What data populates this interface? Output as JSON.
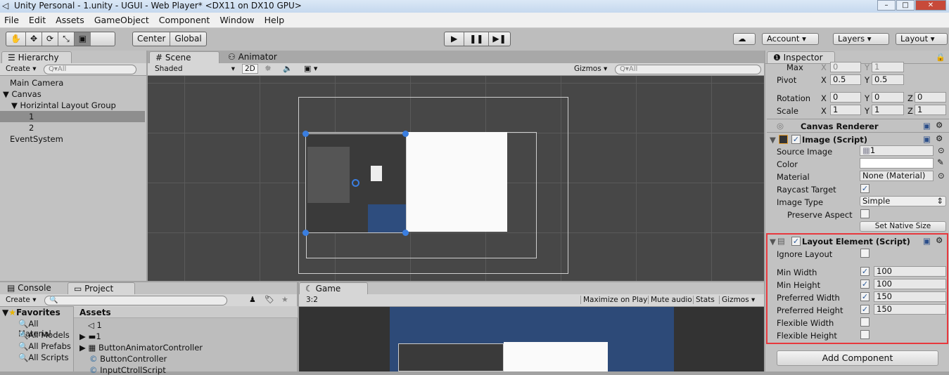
{
  "window": {
    "title": "Unity Personal - 1.unity - UGUI - Web Player* <DX11 on DX10 GPU>",
    "controls": [
      "–",
      "□",
      "✕"
    ]
  },
  "menu": [
    "File",
    "Edit",
    "Assets",
    "GameObject",
    "Component",
    "Window",
    "Help"
  ],
  "toolbar": {
    "tools": [
      "✋",
      "✥",
      "⟳",
      "⤡",
      "▣"
    ],
    "pivot": "Center",
    "space": "Global",
    "play": "▶",
    "pause": "❚❚",
    "step": "▶❚",
    "cloud": "☁",
    "account": "Account",
    "layers": "Layers",
    "layout": "Layout"
  },
  "hierarchy": {
    "tab": "Hierarchy",
    "create": "Create",
    "search": "Q▾All",
    "items": [
      {
        "label": "Main Camera",
        "indent": 0
      },
      {
        "label": "Canvas",
        "indent": 0,
        "arrow": "▼"
      },
      {
        "label": "Horizintal Layout Group",
        "indent": 1,
        "arrow": "▼"
      },
      {
        "label": "1",
        "indent": 2,
        "selected": true
      },
      {
        "label": "2",
        "indent": 2
      },
      {
        "label": "EventSystem",
        "indent": 0
      }
    ]
  },
  "scene": {
    "tab": "Scene",
    "tab2": "Animator",
    "shading": "Shaded",
    "mode2d": "2D",
    "gizmos": "Gizmos",
    "search": "Q▾All"
  },
  "inspector": {
    "tab": "Inspector",
    "rect": {
      "max_label": "Max",
      "max_x": "0",
      "max_y": "1",
      "pivot_label": "Pivot",
      "pivot_x": "0.5",
      "pivot_y": "0.5",
      "rotation_label": "Rotation",
      "rot_x": "0",
      "rot_y": "0",
      "rot_z": "0",
      "scale_label": "Scale",
      "scale_x": "1",
      "scale_y": "1",
      "scale_z": "1"
    },
    "canvas_renderer": "Canvas Renderer",
    "image": {
      "title": "Image (Script)",
      "source_label": "Source Image",
      "source": "1",
      "color_label": "Color",
      "material_label": "Material",
      "material": "None (Material)",
      "raycast_label": "Raycast Target",
      "type_label": "Image Type",
      "type": "Simple",
      "preserve_label": "Preserve Aspect",
      "native": "Set Native Size"
    },
    "layout": {
      "title": "Layout Element (Script)",
      "ignore": "Ignore Layout",
      "min_w_label": "Min Width",
      "min_w": "100",
      "min_h_label": "Min Height",
      "min_h": "100",
      "pref_w_label": "Preferred Width",
      "pref_w": "150",
      "pref_h_label": "Preferred Height",
      "pref_h": "150",
      "flex_w": "Flexible Width",
      "flex_h": "Flexible Height"
    },
    "add_component": "Add Component",
    "highlight_color": "#e8383d"
  },
  "bottom": {
    "console_tab": "Console",
    "project_tab": "Project",
    "create": "Create",
    "favorites": "Favorites",
    "fav_items": [
      "All Material",
      "All Models",
      "All Prefabs",
      "All Scripts"
    ],
    "assets_header": "Assets",
    "assets": [
      "1",
      "1",
      "ButtonAnimatorController",
      "ButtonController",
      "InputCtrollScript"
    ]
  },
  "game": {
    "tab": "Game",
    "aspect": "3:2",
    "maximize": "Maximize on Play",
    "mute": "Mute audio",
    "stats": "Stats",
    "gizmos": "Gizmos"
  }
}
